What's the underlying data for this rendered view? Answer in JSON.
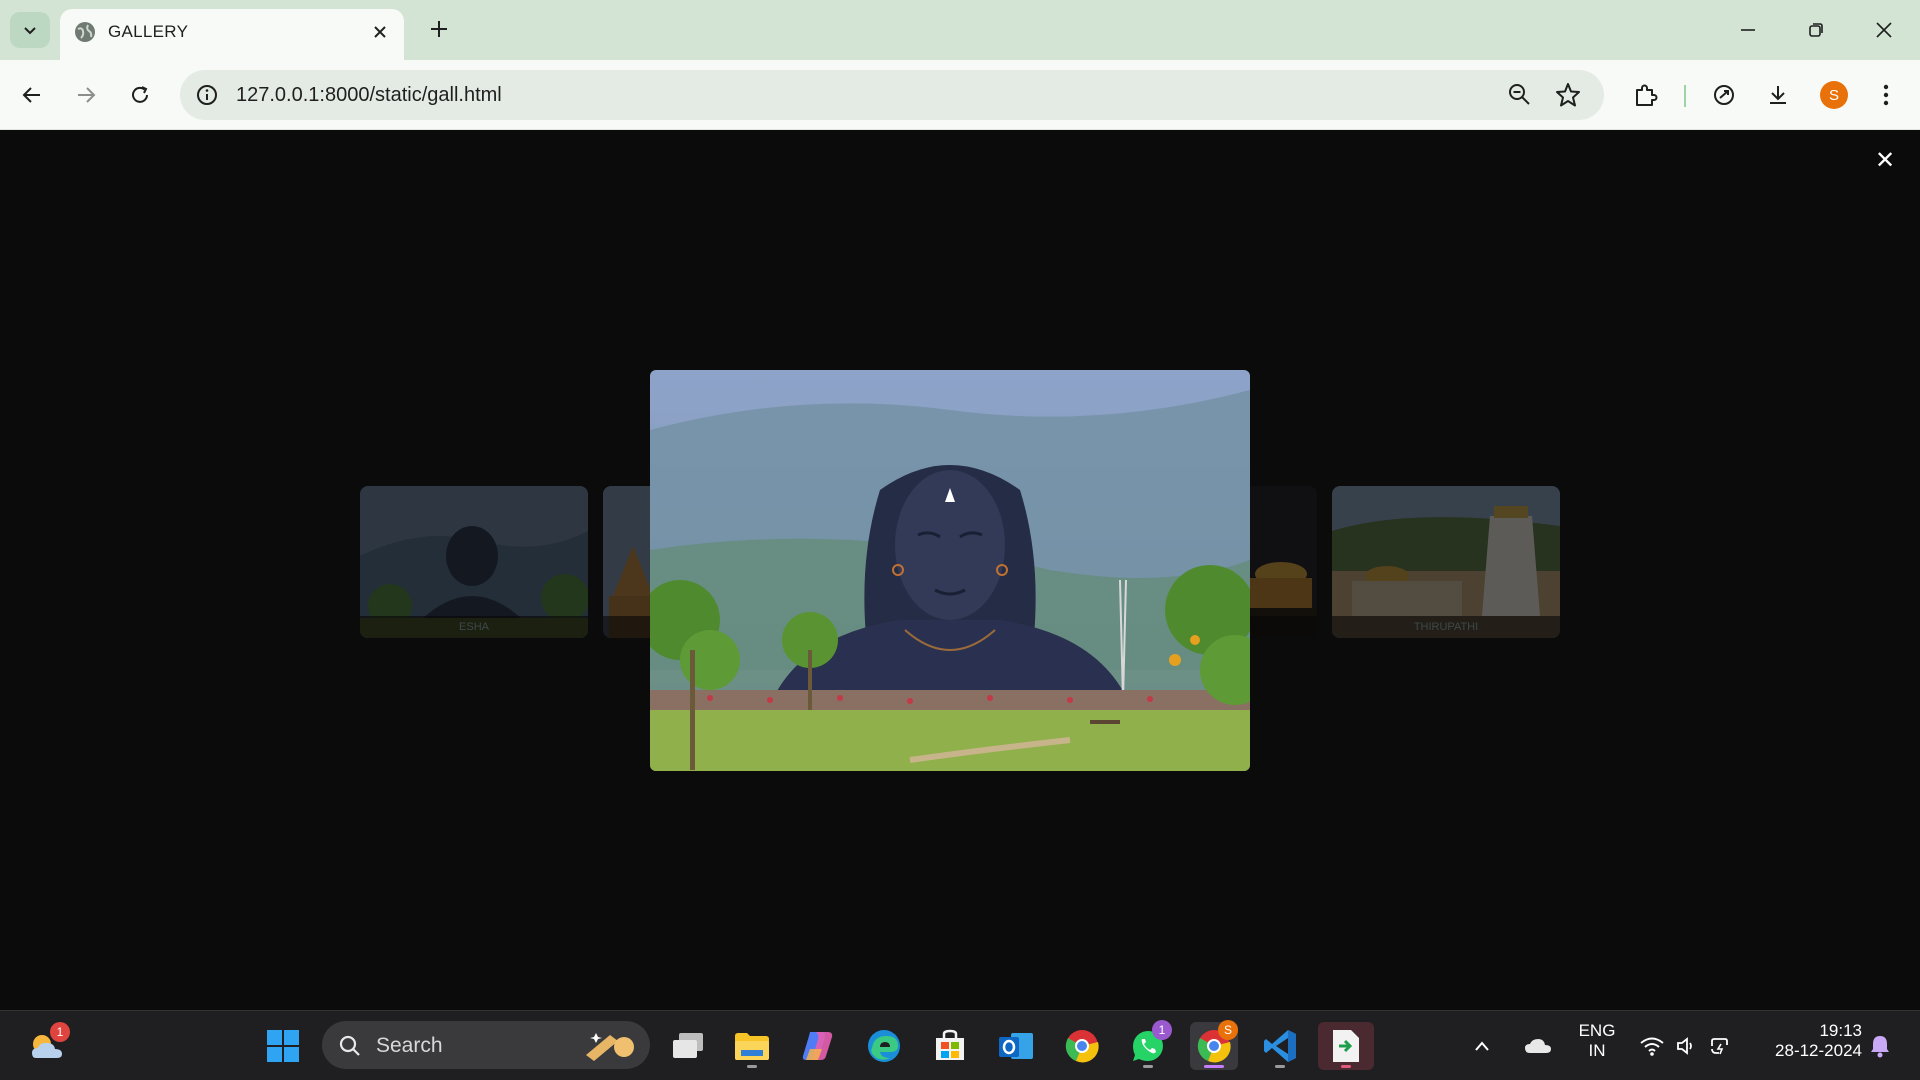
{
  "browser": {
    "tab": {
      "title": "GALLERY"
    },
    "url": "127.0.0.1:8000/static/gall.html",
    "profile_initial": "S"
  },
  "gallery": {
    "close_symbol": "✕",
    "thumbnails": [
      {
        "caption": "ESHA"
      },
      {
        "caption": ""
      },
      {
        "caption": ""
      },
      {
        "caption": "THIRUPATHI"
      }
    ]
  },
  "taskbar": {
    "search_placeholder": "Search",
    "weather_badge": "1",
    "whatsapp_badge": "1",
    "chrome_profile_badge": "S",
    "language": {
      "line1": "ENG",
      "line2": "IN"
    },
    "clock": {
      "time": "19:13",
      "date": "28-12-2024"
    }
  },
  "colors": {
    "tabstrip": "#d3e3d4",
    "toolbar": "#f7faf7",
    "page_bg": "#0b0b0b",
    "taskbar": "#1f1f22",
    "profile": "#e8710a"
  }
}
